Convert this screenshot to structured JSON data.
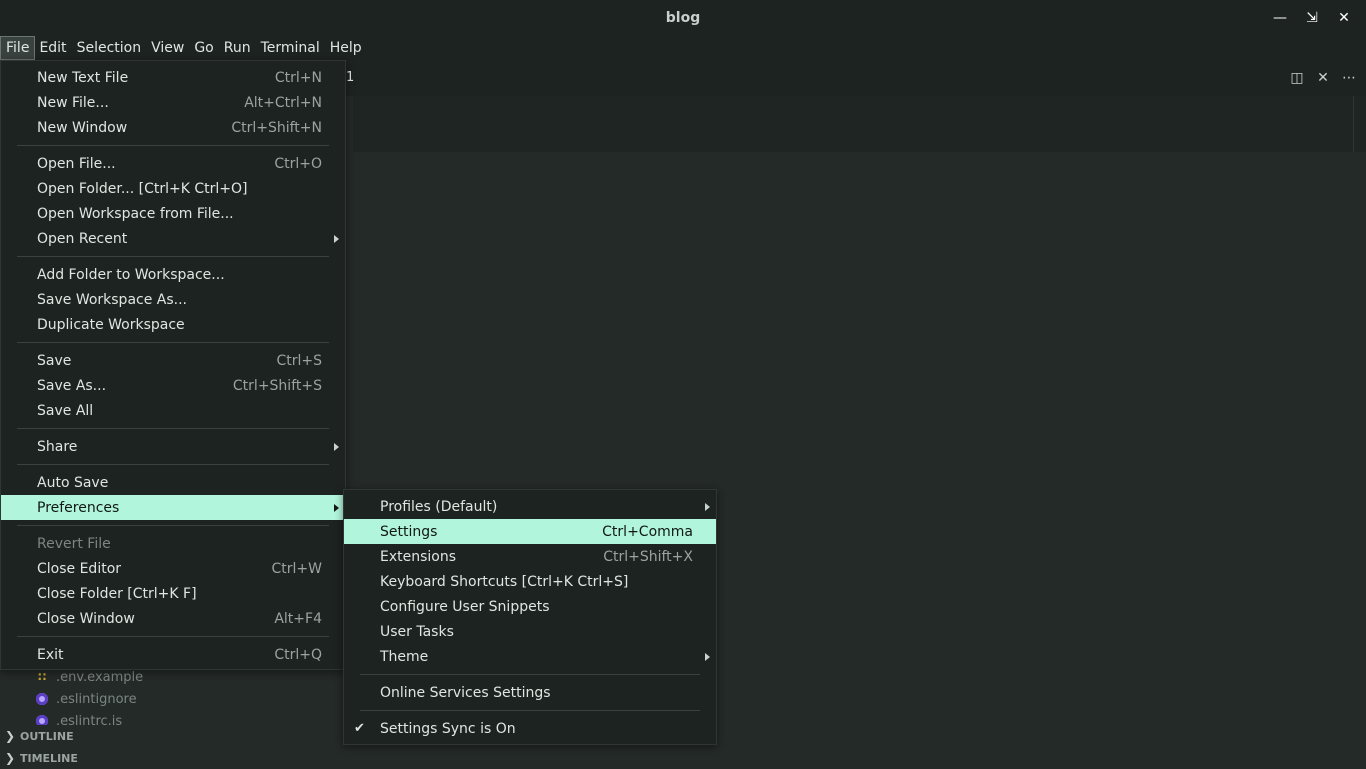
{
  "window": {
    "title": "blog",
    "controls": [
      "minimize-icon",
      "restore-icon",
      "close-icon"
    ]
  },
  "menubar": [
    "File",
    "Edit",
    "Selection",
    "View",
    "Go",
    "Run",
    "Terminal",
    "Help"
  ],
  "editor": {
    "tab_fragment": "1"
  },
  "file_menu": {
    "items": [
      {
        "label": "New Text File",
        "kb": "Ctrl+N"
      },
      {
        "label": "New File...",
        "kb": "Alt+Ctrl+N"
      },
      {
        "label": "New Window",
        "kb": "Ctrl+Shift+N"
      },
      {
        "label": "Open File...",
        "kb": "Ctrl+O"
      },
      {
        "label": "Open Folder... [Ctrl+K Ctrl+O]",
        "kb": ""
      },
      {
        "label": "Open Workspace from File...",
        "kb": ""
      },
      {
        "label": "Open Recent",
        "kb": ""
      },
      {
        "label": "Add Folder to Workspace...",
        "kb": ""
      },
      {
        "label": "Save Workspace As...",
        "kb": ""
      },
      {
        "label": "Duplicate Workspace",
        "kb": ""
      },
      {
        "label": "Save",
        "kb": "Ctrl+S"
      },
      {
        "label": "Save As...",
        "kb": "Ctrl+Shift+S"
      },
      {
        "label": "Save All",
        "kb": ""
      },
      {
        "label": "Share",
        "kb": ""
      },
      {
        "label": "Auto Save",
        "kb": ""
      },
      {
        "label": "Preferences",
        "kb": ""
      },
      {
        "label": "Revert File",
        "kb": ""
      },
      {
        "label": "Close Editor",
        "kb": "Ctrl+W"
      },
      {
        "label": "Close Folder [Ctrl+K F]",
        "kb": ""
      },
      {
        "label": "Close Window",
        "kb": "Alt+F4"
      },
      {
        "label": "Exit",
        "kb": "Ctrl+Q"
      }
    ]
  },
  "preferences_menu": {
    "items": [
      {
        "label": "Profiles (Default)",
        "kb": ""
      },
      {
        "label": "Settings",
        "kb": "Ctrl+Comma"
      },
      {
        "label": "Extensions",
        "kb": "Ctrl+Shift+X"
      },
      {
        "label": "Keyboard Shortcuts [Ctrl+K Ctrl+S]",
        "kb": ""
      },
      {
        "label": "Configure User Snippets",
        "kb": ""
      },
      {
        "label": "User Tasks",
        "kb": ""
      },
      {
        "label": "Theme",
        "kb": ""
      },
      {
        "label": "Online Services Settings",
        "kb": ""
      },
      {
        "label": "Settings Sync is On",
        "kb": ""
      }
    ]
  },
  "explorer": {
    "files": [
      ".env.example",
      ".eslintignore",
      ".eslintrc.js"
    ],
    "sections": [
      "OUTLINE",
      "TIMELINE"
    ]
  },
  "colors": {
    "highlight": "#b2f5dd",
    "menu_bg": "#1d2321",
    "editor_bg": "#242a28"
  }
}
